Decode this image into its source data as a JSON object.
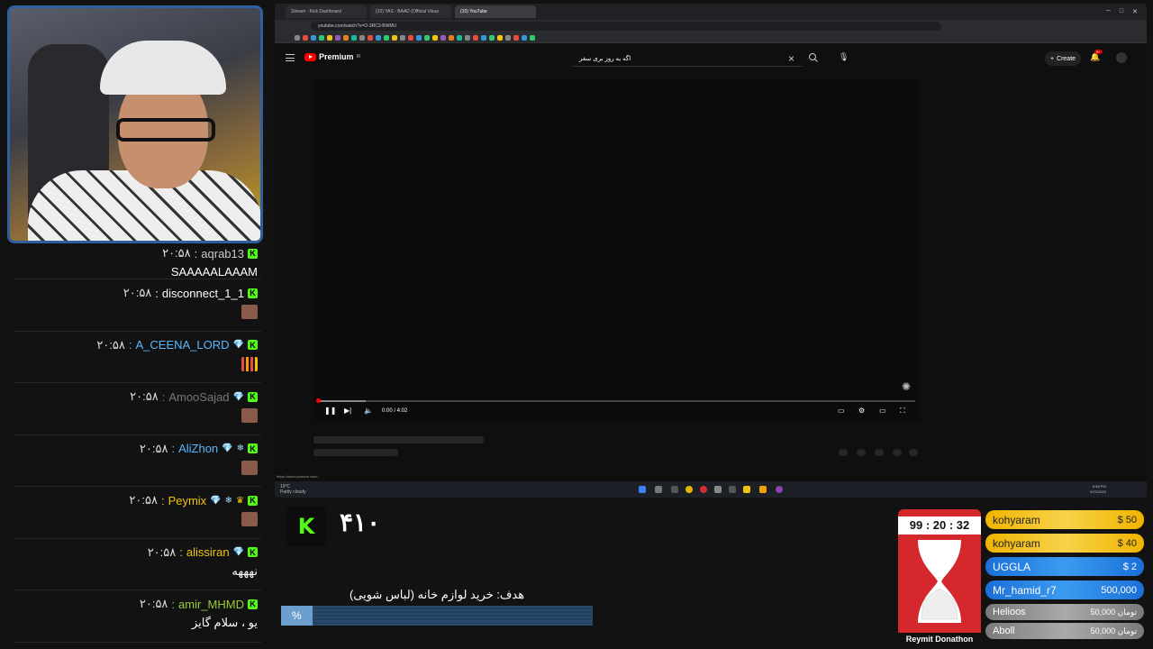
{
  "browser": {
    "tabs": [
      {
        "label": "Stream - Kick Dashboard",
        "active": false
      },
      {
        "label": "(10) YAS - BAAD (Official Visua",
        "active": false
      },
      {
        "label": "(10) YouTube",
        "active": true
      }
    ],
    "url": "youtube.com/watch?v=O-3RC3-BWMU"
  },
  "youtube": {
    "logo_text": "Premium",
    "logo_sup": "IR",
    "search_query": "اگه یه روز بری سفر",
    "create_label": "Create",
    "notification_count": "9+",
    "timecode": "0:00 / 4:02",
    "progress_fraction": 0.0,
    "buffered_fraction": 0.08,
    "status_url": "https://www.youtube.com/",
    "weather_temp": "19°C",
    "weather_text": "Partly cloudy",
    "clock_time": "8:58 PM",
    "clock_date": "9/23/2025"
  },
  "chat": {
    "messages": [
      {
        "time": "۲۰:۵۸",
        "user": "aqrab13",
        "user_color": "#c9c9c9",
        "badges": [
          "kick"
        ],
        "text": "SAAAAALAAAM",
        "emote": ""
      },
      {
        "time": "۲۰:۵۸",
        "user": "disconnect_1_1",
        "user_color": "#ffffff",
        "badges": [
          "kick"
        ],
        "text": "",
        "emote": "face"
      },
      {
        "time": "۲۰:۵۸",
        "user": "A_CEENA_LORD",
        "user_color": "#5ab8ff",
        "badges": [
          "diamond",
          "kick"
        ],
        "text": "",
        "emote": "bars"
      },
      {
        "time": "۲۰:۵۸",
        "user": "AmooSajad",
        "user_color": "#777777",
        "badges": [
          "diamond",
          "kick"
        ],
        "text": "",
        "emote": "face"
      },
      {
        "time": "۲۰:۵۸",
        "user": "AliZhon",
        "user_color": "#5ab8ff",
        "badges": [
          "diamond",
          "snow",
          "kick"
        ],
        "text": "",
        "emote": "face"
      },
      {
        "time": "۲۰:۵۸",
        "user": "Peymix",
        "user_color": "#f1c40f",
        "badges": [
          "diamond",
          "snow",
          "crown",
          "kick"
        ],
        "text": "",
        "emote": "face"
      },
      {
        "time": "۲۰:۵۸",
        "user": "alissiran",
        "user_color": "#f1c40f",
        "badges": [
          "diamond",
          "kick"
        ],
        "text": "نهههه",
        "emote": ""
      },
      {
        "time": "۲۰:۵۸",
        "user": "amir_MHMD",
        "user_color": "#9acd32",
        "badges": [
          "kick"
        ],
        "text": "یو ، سلام گایز",
        "emote": ""
      }
    ]
  },
  "kick": {
    "logo_letter": "K",
    "follower_count": "۴۱۰"
  },
  "goal": {
    "text": "هدف: خرید لوازم خانه (لباس شویی)",
    "percent_label": "%",
    "progress_fraction": 0.1
  },
  "timer": {
    "text": "99 : 20 : 32",
    "label": "Reymit Donathon"
  },
  "donors": [
    {
      "name": "kohyaram",
      "amount": "$ 50",
      "style": "gold"
    },
    {
      "name": "kohyaram",
      "amount": "$ 40",
      "style": "gold"
    },
    {
      "name": "UGGLA",
      "amount": "$ 2",
      "style": "blue"
    },
    {
      "name": "Mr_hamid_r7",
      "amount": "500,000",
      "style": "blue"
    },
    {
      "name": "Helioos",
      "amount": "50,000 تومان",
      "style": "gray"
    },
    {
      "name": "Aboll",
      "amount": "50,000 تومان",
      "style": "gray"
    }
  ],
  "colors": {
    "kick_green": "#53fc18",
    "youtube_red": "#ff0000",
    "timer_red": "#d4282c"
  }
}
